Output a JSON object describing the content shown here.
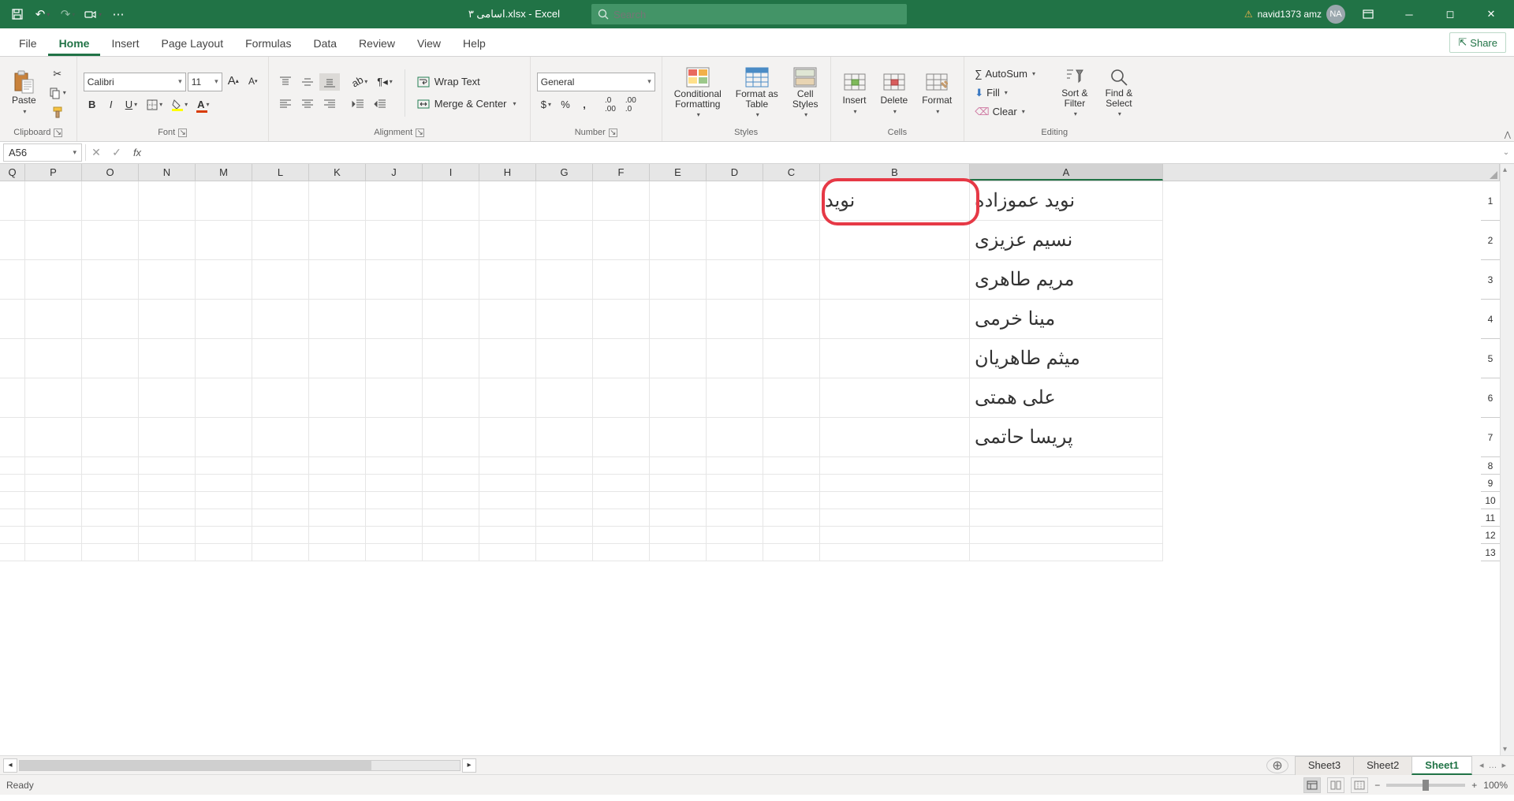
{
  "titlebar": {
    "filename": "اسامی ۳.xlsx - Excel",
    "search_placeholder": "Search",
    "user_name": "navid1373 amz",
    "user_initials": "NA"
  },
  "tabs": {
    "items": [
      "File",
      "Home",
      "Insert",
      "Page Layout",
      "Formulas",
      "Data",
      "Review",
      "View",
      "Help"
    ],
    "active": 1,
    "share": "Share"
  },
  "ribbon": {
    "clipboard": {
      "label": "Clipboard",
      "paste": "Paste"
    },
    "font": {
      "label": "Font",
      "name": "Calibri",
      "size": "11"
    },
    "alignment": {
      "label": "Alignment",
      "wrap": "Wrap Text",
      "merge": "Merge & Center"
    },
    "number": {
      "label": "Number",
      "format": "General"
    },
    "styles": {
      "label": "Styles",
      "conditional": "Conditional\nFormatting",
      "format_as": "Format as\nTable",
      "cell": "Cell\nStyles"
    },
    "cells": {
      "label": "Cells",
      "insert": "Insert",
      "delete": "Delete",
      "format": "Format"
    },
    "editing": {
      "label": "Editing",
      "autosum": "AutoSum",
      "fill": "Fill",
      "clear": "Clear",
      "sort": "Sort &\nFilter",
      "find": "Find &\nSelect"
    }
  },
  "formula_bar": {
    "name_box": "A56",
    "formula": ""
  },
  "columns": [
    "Q",
    "P",
    "O",
    "N",
    "M",
    "L",
    "K",
    "J",
    "I",
    "H",
    "G",
    "F",
    "E",
    "D",
    "C",
    "B",
    "A"
  ],
  "col_widths": {
    "default": 72,
    "Q": 32,
    "B": 190,
    "A": 245
  },
  "data": {
    "A": [
      "نوید عموزاده",
      "نسیم عزیزی",
      "مریم طاهری",
      "مینا خرمی",
      "میثم طاهریان",
      "علی همتی",
      "پریسا حاتمی"
    ],
    "B": [
      "نوید",
      "",
      "",
      "",
      "",
      "",
      ""
    ]
  },
  "sheets": {
    "items": [
      "Sheet3",
      "Sheet2",
      "Sheet1"
    ],
    "active": 2
  },
  "status": {
    "ready": "Ready",
    "zoom": "100%"
  }
}
